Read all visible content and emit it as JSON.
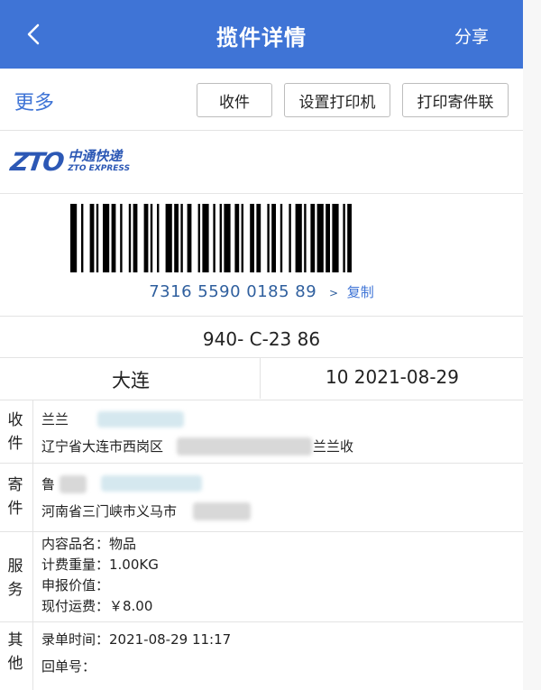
{
  "header": {
    "title": "揽件详情",
    "share_label": "分享",
    "back_icon": "chevron-left-icon",
    "background": "#3f74d6"
  },
  "toolbar": {
    "more_label": "更多",
    "receive_label": "收件",
    "printer_label": "设置打印机",
    "print_label": "打印寄件联"
  },
  "brand": {
    "logo_mark": "ZTO",
    "name_cn": "中通快递",
    "name_en": "ZTO EXPRESS",
    "color": "#2c58b5"
  },
  "waybill": {
    "tracking_number": "7316 5590 0185 89",
    "arrow": ">",
    "copy_label": "复制",
    "sort_code": "940- C-23 86"
  },
  "route": {
    "city": "大连",
    "date_info": "10  2021-08-29"
  },
  "receiver": {
    "section_label": [
      "收",
      "件"
    ],
    "name": "兰兰",
    "address_prefix": "辽宁省大连市西岗区",
    "address_suffix": "兰兰收"
  },
  "sender": {
    "section_label": [
      "寄",
      "件"
    ],
    "name": "鲁",
    "address": "河南省三门峡市义马市"
  },
  "service": {
    "section_label": [
      "服",
      "务"
    ],
    "lines": [
      "内容品名：物品",
      "计费重量：1.00KG",
      "申报价值：",
      "现付运费：￥8.00"
    ]
  },
  "other": {
    "section_label": [
      "其",
      "他"
    ],
    "lines": [
      "录单时间：2021-08-29 11:17",
      "回单号："
    ]
  }
}
